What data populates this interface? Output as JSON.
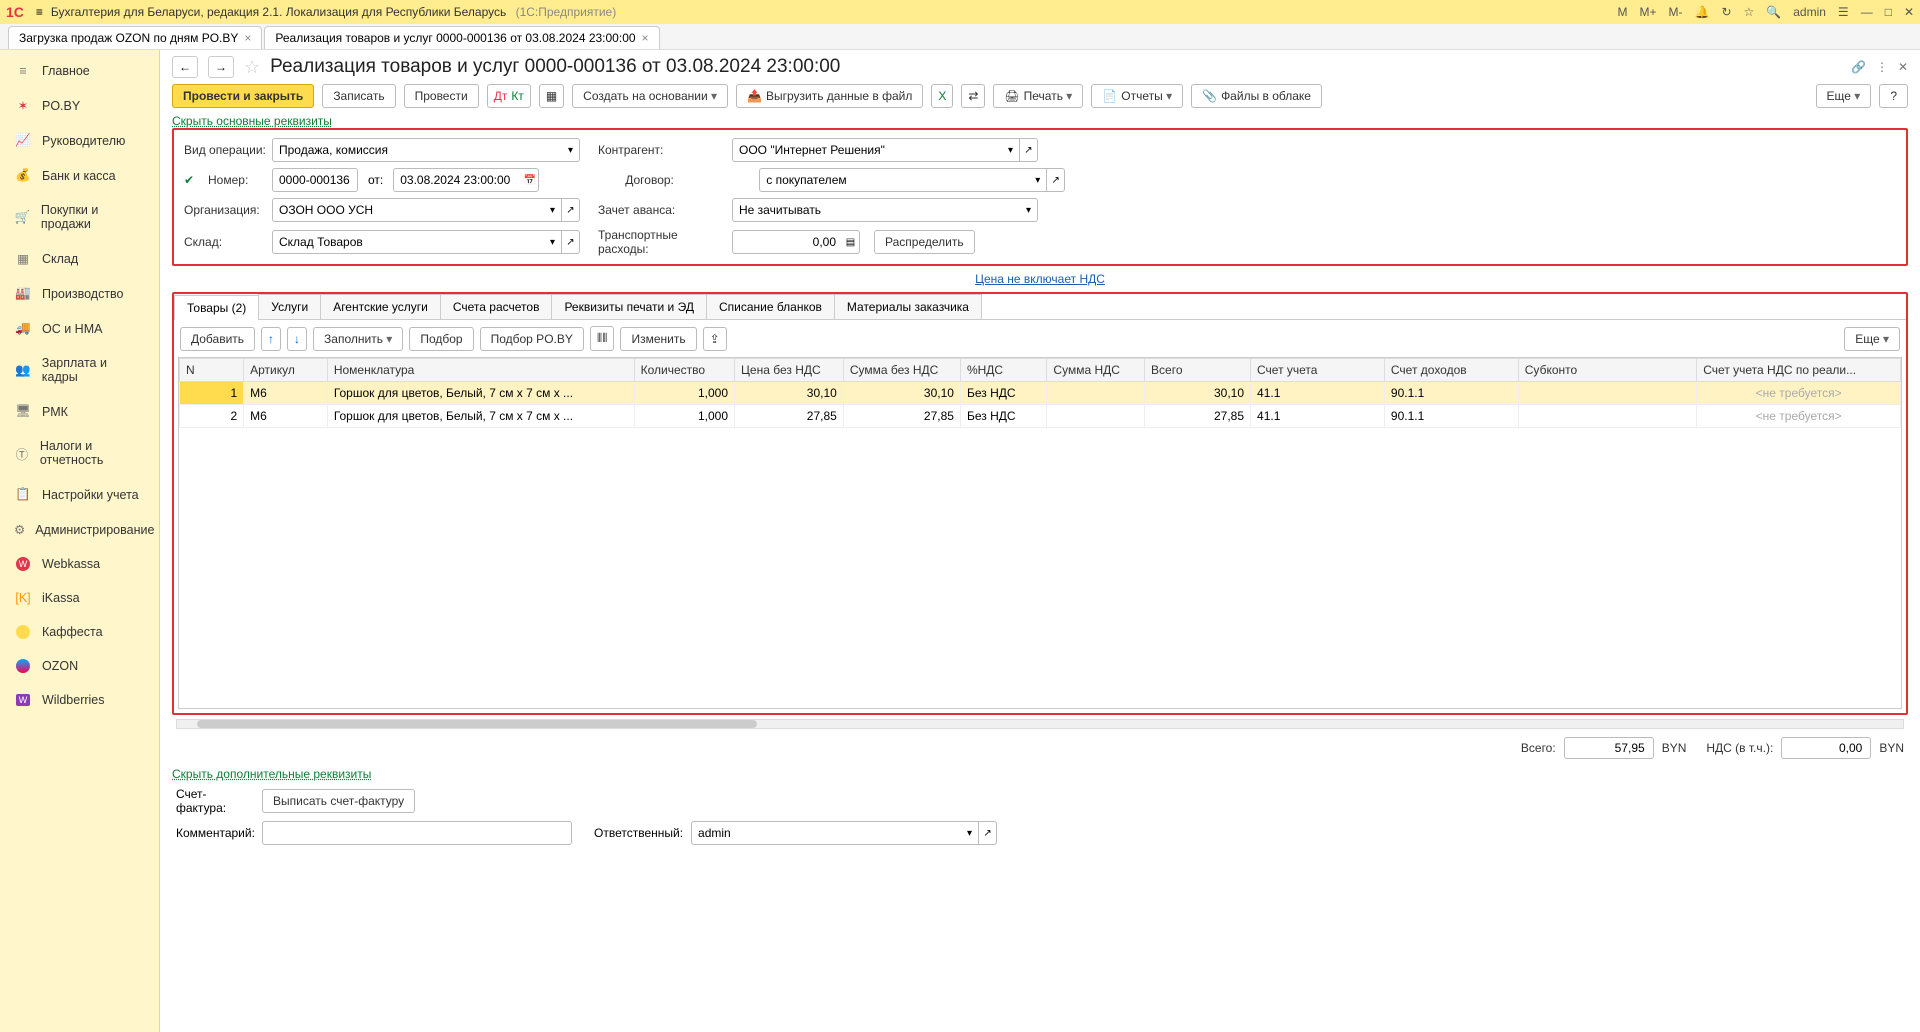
{
  "titlebar": {
    "logo": "1С",
    "title_main": "Бухгалтерия для Беларуси, редакция 2.1. Локализация для Республики Беларусь",
    "title_sub": "(1С:Предприятие)",
    "m": "М",
    "mplus": "М+",
    "mminus": "М-",
    "user": "admin"
  },
  "tabs": {
    "t0": "Загрузка продаж OZON по дням PO.BY",
    "t1": "Реализация товаров и услуг 0000-000136 от 03.08.2024 23:00:00"
  },
  "sidebar": {
    "main": "Главное",
    "poby": "PO.BY",
    "ruk": "Руководителю",
    "bank": "Банк и касса",
    "pok": "Покупки и продажи",
    "sklad": "Склад",
    "proiz": "Производство",
    "os": "ОС и НМА",
    "zp": "Зарплата и кадры",
    "rmk": "РМК",
    "nalog": "Налоги и отчетность",
    "nast": "Настройки учета",
    "admin": "Администрирование",
    "web": "Webkassa",
    "ik": "iKassa",
    "kaf": "Каффеста",
    "ozon": "OZON",
    "wb": "Wildberries"
  },
  "header": {
    "title": "Реализация товаров и услуг 0000-000136 от 03.08.2024 23:00:00"
  },
  "toolbar": {
    "post_close": "Провести и закрыть",
    "write": "Записать",
    "post": "Провести",
    "create_based": "Создать на основании",
    "export": "Выгрузить данные в файл",
    "print": "Печать",
    "reports": "Отчеты",
    "cloud": "Файлы в облаке",
    "more": "Еще",
    "help": "?"
  },
  "links": {
    "hide_main": "Скрыть основные реквизиты",
    "price_no_vat": "Цена не включает НДС",
    "hide_extra": "Скрыть дополнительные реквизиты"
  },
  "form": {
    "op_lbl": "Вид операции:",
    "op_val": "Продажа, комиссия",
    "num_lbl": "Номер:",
    "num_val": "0000-000136",
    "from_lbl": "от:",
    "date_val": "03.08.2024 23:00:00",
    "org_lbl": "Организация:",
    "org_val": "ОЗОН ООО УСН",
    "wh_lbl": "Склад:",
    "wh_val": "Склад Товаров",
    "ctr_lbl": "Контрагент:",
    "ctr_val": "ООО \"Интернет Решения\"",
    "dog_lbl": "Договор:",
    "dog_val": "с покупателем",
    "adv_lbl": "Зачет аванса:",
    "adv_val": "Не зачитывать",
    "tr_lbl": "Транспортные расходы:",
    "tr_val": "0,00",
    "distr": "Распределить"
  },
  "itabs": {
    "goods": "Товары (2)",
    "serv": "Услуги",
    "agent": "Агентские услуги",
    "acc": "Счета расчетов",
    "print": "Реквизиты печати и ЭД",
    "blank": "Списание бланков",
    "mat": "Материалы заказчика"
  },
  "itoolbar": {
    "add": "Добавить",
    "fill": "Заполнить",
    "pick": "Подбор",
    "pickpo": "Подбор PO.BY",
    "edit": "Изменить",
    "more": "Еще"
  },
  "grid": {
    "cols": {
      "n": "N",
      "art": "Артикул",
      "nom": "Номенклатура",
      "qty": "Количество",
      "price": "Цена без НДС",
      "sum": "Сумма без НДС",
      "vatp": "%НДС",
      "vatsum": "Сумма НДС",
      "total": "Всего",
      "acc": "Счет учета",
      "inc": "Счет доходов",
      "sub": "Субконто",
      "vatacc": "Счет учета НДС по реали..."
    },
    "r1": {
      "n": "1",
      "art": "M6",
      "nom": "Горшок для цветов, Белый, 7 см x 7 см x ...",
      "qty": "1,000",
      "price": "30,10",
      "sum": "30,10",
      "vatp": "Без НДС",
      "vatsum": "",
      "total": "30,10",
      "acc": "41.1",
      "inc": "90.1.1",
      "vatacc": "<не требуется>"
    },
    "r2": {
      "n": "2",
      "art": "M6",
      "nom": "Горшок для цветов, Белый, 7 см x 7 см x ...",
      "qty": "1,000",
      "price": "27,85",
      "sum": "27,85",
      "vatp": "Без НДС",
      "vatsum": "",
      "total": "27,85",
      "acc": "41.1",
      "inc": "90.1.1",
      "vatacc": "<не требуется>"
    }
  },
  "totals": {
    "all_lbl": "Всего:",
    "all_val": "57,95",
    "cur": "BYN",
    "vat_lbl": "НДС (в т.ч.):",
    "vat_val": "0,00"
  },
  "bottom": {
    "sf_lbl": "Счет-фактура:",
    "sf_btn": "Выписать счет-фактуру",
    "comm_lbl": "Комментарий:",
    "resp_lbl": "Ответственный:",
    "resp_val": "admin"
  }
}
